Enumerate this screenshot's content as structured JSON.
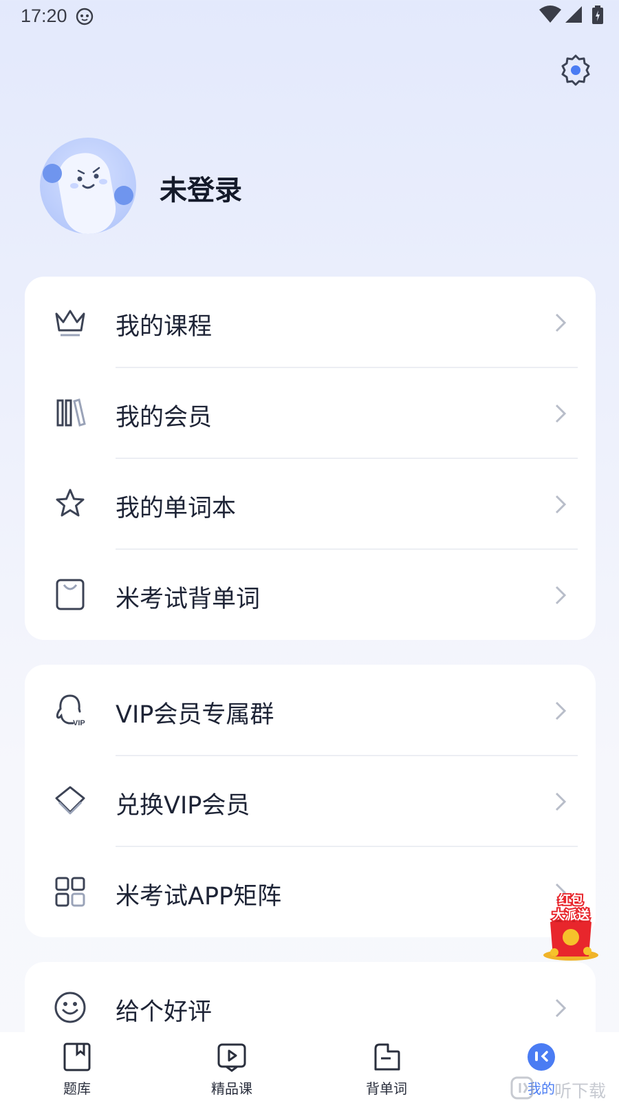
{
  "status_bar": {
    "time": "17:20"
  },
  "profile": {
    "username": "未登录"
  },
  "menu_group_1": [
    {
      "label": "我的课程",
      "icon": "crown-icon"
    },
    {
      "label": "我的会员",
      "icon": "books-icon"
    },
    {
      "label": "我的单词本",
      "icon": "star-icon"
    },
    {
      "label": "米考试背单词",
      "icon": "bag-icon"
    }
  ],
  "menu_group_2": [
    {
      "label": "VIP会员专属群",
      "icon": "qq-vip-icon"
    },
    {
      "label": "兑换VIP会员",
      "icon": "diamond-icon"
    },
    {
      "label": "米考试APP矩阵",
      "icon": "grid-icon"
    }
  ],
  "menu_group_3": [
    {
      "label": "给个好评",
      "icon": "smile-icon"
    }
  ],
  "promo": {
    "line1": "红包",
    "line2": "大派送"
  },
  "tabbar": {
    "tabs": [
      {
        "label": "题库",
        "icon": "book-icon"
      },
      {
        "label": "精品课",
        "icon": "video-icon"
      },
      {
        "label": "背单词",
        "icon": "card-icon"
      },
      {
        "label": "我的",
        "icon": "profile-face-icon",
        "active": true
      }
    ]
  },
  "watermark": {
    "text": "听下载"
  },
  "colors": {
    "accent": "#4a7cf3",
    "promo_red": "#e8262c",
    "card_bg": "#ffffff"
  }
}
